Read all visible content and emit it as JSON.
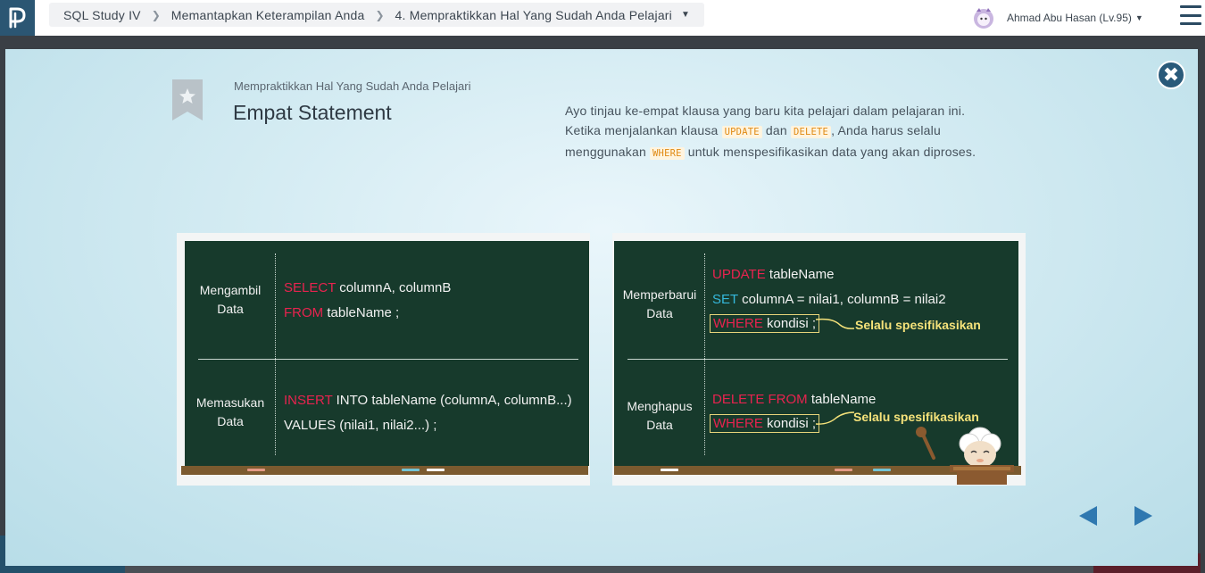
{
  "breadcrumb": {
    "course": "SQL Study IV",
    "section": "Memantapkan Keterampilan Anda",
    "lesson": "4. Mempraktikkan Hal Yang Sudah Anda Pelajari"
  },
  "user": {
    "name": "Ahmad Abu Hasan (Lv.95)"
  },
  "modal": {
    "subtitle": "Mempraktikkan Hal Yang Sudah Anda Pelajari",
    "title": "Empat Statement",
    "desc_line1": "Ayo tinjau ke-empat klausa yang baru kita pelajari dalam pelajaran ini.",
    "desc_line2_a": "Ketika menjalankan klausa",
    "desc_kw_update": "UPDATE",
    "desc_line2_b": "dan",
    "desc_kw_delete": "DELETE",
    "desc_line2_c": ", Anda harus selalu",
    "desc_line3_a": "menggunakan",
    "desc_kw_where": "WHERE",
    "desc_line3_b": "untuk menspesifikasikan data yang akan diproses."
  },
  "board_left": {
    "select": {
      "label_1": "Mengambil",
      "label_2": "Data",
      "kw_select": "SELECT",
      "cols": "columnA, columnB",
      "kw_from": "FROM",
      "table": "tableName ;"
    },
    "insert": {
      "label_1": "Memasukan",
      "label_2": "Data",
      "kw_insert": "INSERT",
      "rest": "INTO tableName  (columnA, columnB...)",
      "values": "VALUES  (nilai1, nilai2...)  ;"
    }
  },
  "board_right": {
    "update": {
      "label_1": "Memperbarui",
      "label_2": "Data",
      "kw_update": "UPDATE",
      "table": "tableName",
      "kw_set": "SET",
      "assign": "columnA = nilai1, columnB = nilai2",
      "kw_where": "WHERE",
      "cond": "kondisi ;",
      "note": "Selalu spesifikasikan"
    },
    "delete": {
      "label_1": "Menghapus",
      "label_2": "Data",
      "kw_delete": "DELETE FROM",
      "table": "tableName",
      "kw_where": "WHERE",
      "cond": "kondisi ;",
      "note": "Selalu spesifikasikan"
    }
  },
  "colors": {
    "keyword_red": "#e8234f",
    "keyword_blue": "#35b8dc",
    "board_green": "#173a2c",
    "note_yellow": "#f5e27a",
    "close_button": "#2a5a7a",
    "nav_arrow": "#2f78b0"
  },
  "icons": {
    "logo": "progate-logo-icon",
    "close": "close-icon",
    "bookmark": "star-bookmark-icon",
    "prev": "arrow-left-icon",
    "next": "arrow-right-icon",
    "menu": "hamburger-menu-icon"
  }
}
